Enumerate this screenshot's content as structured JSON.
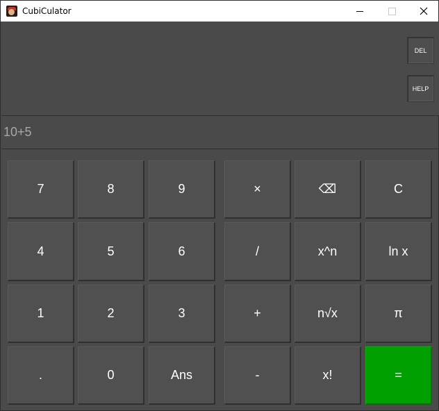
{
  "window": {
    "title": "CubiCulator",
    "controls": {
      "minimize": "minimize",
      "maximize": "maximize",
      "close": "close"
    }
  },
  "side_buttons": {
    "del": "DEL",
    "help": "HELP"
  },
  "display": {
    "expression": "10+5"
  },
  "keypad": {
    "r1": [
      "7",
      "8",
      "9",
      "×",
      "⌫",
      "C"
    ],
    "r2": [
      "4",
      "5",
      "6",
      "/",
      "x^n",
      "ln x"
    ],
    "r3": [
      "1",
      "2",
      "3",
      "+",
      "n√x",
      "π"
    ],
    "r4": [
      ".",
      "0",
      "Ans",
      "-",
      "x!",
      "="
    ]
  },
  "colors": {
    "background": "#4a4a4a",
    "key": "#505050",
    "equals": "#00a000",
    "display_text": "#a8a8a8"
  }
}
